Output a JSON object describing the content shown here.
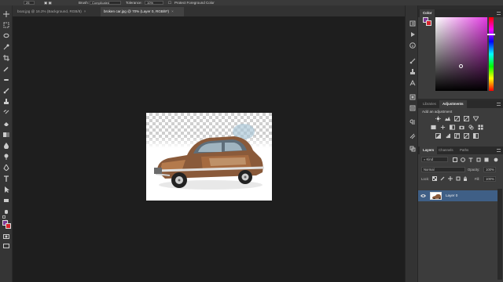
{
  "options_bar": {
    "opt1_value": "25",
    "mode_label": "Brush:",
    "mode_value": "Complicated",
    "tolerance_label": "Tolerance:",
    "tolerance_value": "10%",
    "protect_label": "Protect Foreground Color"
  },
  "document_tabs": [
    {
      "label": "boat.jpg @ 16.2% (Background, RGB/8)",
      "close": "×"
    },
    {
      "label": "broken car.jpg @ 70% (Layer 0, RGB/8*)",
      "close": "×"
    }
  ],
  "color_panel": {
    "tab": "Color",
    "foreground": "#7c3a95",
    "background": "#d6242c"
  },
  "adjustments_panel": {
    "tabs": [
      "Libraries",
      "Adjustments"
    ],
    "active_tab": "Adjustments",
    "title": "Add an adjustment"
  },
  "layers_panel": {
    "tabs": [
      "Layers",
      "Channels",
      "Paths"
    ],
    "active_tab": "Layers",
    "kind_label": "Kind",
    "blend_mode": "Normal",
    "opacity_label": "Opacity:",
    "opacity_value": "100%",
    "lock_label": "Lock:",
    "fill_label": "Fill:",
    "fill_value": "100%",
    "layers": [
      {
        "name": "Layer 0",
        "selected": true,
        "visible": true
      }
    ]
  },
  "colors": {
    "accent": "#3f5f86",
    "panel_bg": "#3c3c3c",
    "canvas_bg": "#1e1e1e"
  },
  "icons": {
    "toolbar": [
      "move-icon",
      "marquee-icon",
      "lasso-icon",
      "quick-select-icon",
      "crop-icon",
      "eyedropper-icon",
      "healing-icon",
      "brush-icon",
      "stamp-icon",
      "history-brush-icon",
      "eraser-icon",
      "gradient-icon",
      "blur-icon",
      "dodge-icon",
      "pen-icon",
      "type-icon",
      "path-select-icon",
      "rectangle-icon",
      "hand-icon",
      "zoom-icon"
    ],
    "strip": [
      "history-icon",
      "play-icon",
      "info-icon",
      "brush-settings-icon",
      "character-icon",
      "paragraph-icon",
      "styles-icon",
      "notes-icon",
      "clone-source-icon",
      "3d-icon",
      "properties-icon"
    ]
  }
}
